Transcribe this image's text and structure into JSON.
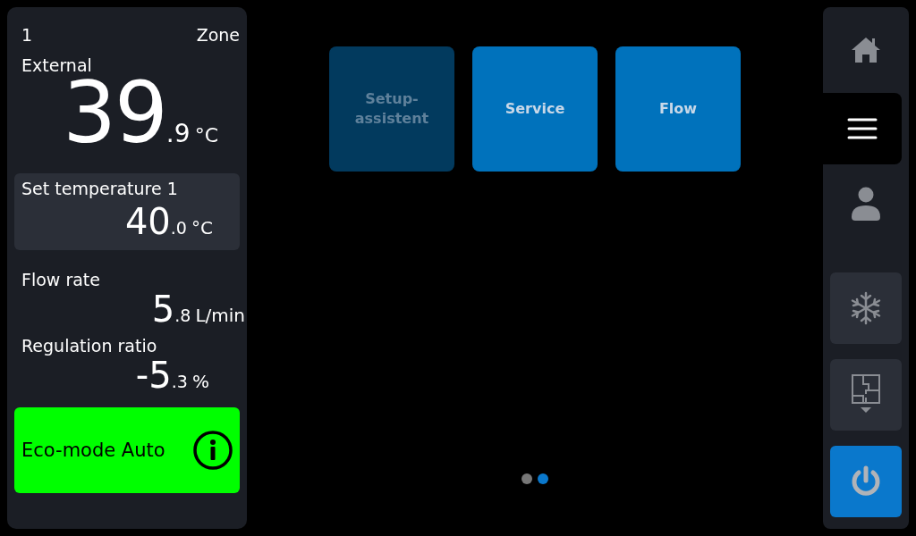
{
  "zone": {
    "number": "1",
    "label": "Zone"
  },
  "external": {
    "label": "External",
    "integer": "39",
    "decimal": ".9",
    "unit": "°C"
  },
  "setpoint": {
    "label": "Set temperature 1",
    "integer": "40",
    "decimal": ".0",
    "unit": "°C"
  },
  "readings": [
    {
      "label": "Flow rate",
      "integer": "5",
      "decimal": ".8",
      "unit": "L/min"
    },
    {
      "label": "Regulation ratio",
      "integer": "-5",
      "decimal": ".3",
      "unit": "%"
    }
  ],
  "eco": {
    "label": "Eco-mode Auto"
  },
  "tiles": [
    {
      "label": "Setup-assistent",
      "disabled": true
    },
    {
      "label": "Service",
      "disabled": false
    },
    {
      "label": "Flow",
      "disabled": false
    }
  ],
  "pages": [
    {
      "selected": false
    },
    {
      "selected": true
    }
  ],
  "nav": [
    {
      "kind": "home",
      "selected": false
    },
    {
      "kind": "menu",
      "selected": true
    },
    {
      "kind": "user",
      "selected": false
    }
  ],
  "actions": [
    {
      "kind": "snowflake",
      "active": false
    },
    {
      "kind": "zone",
      "active": false
    },
    {
      "kind": "power",
      "active": true
    }
  ]
}
